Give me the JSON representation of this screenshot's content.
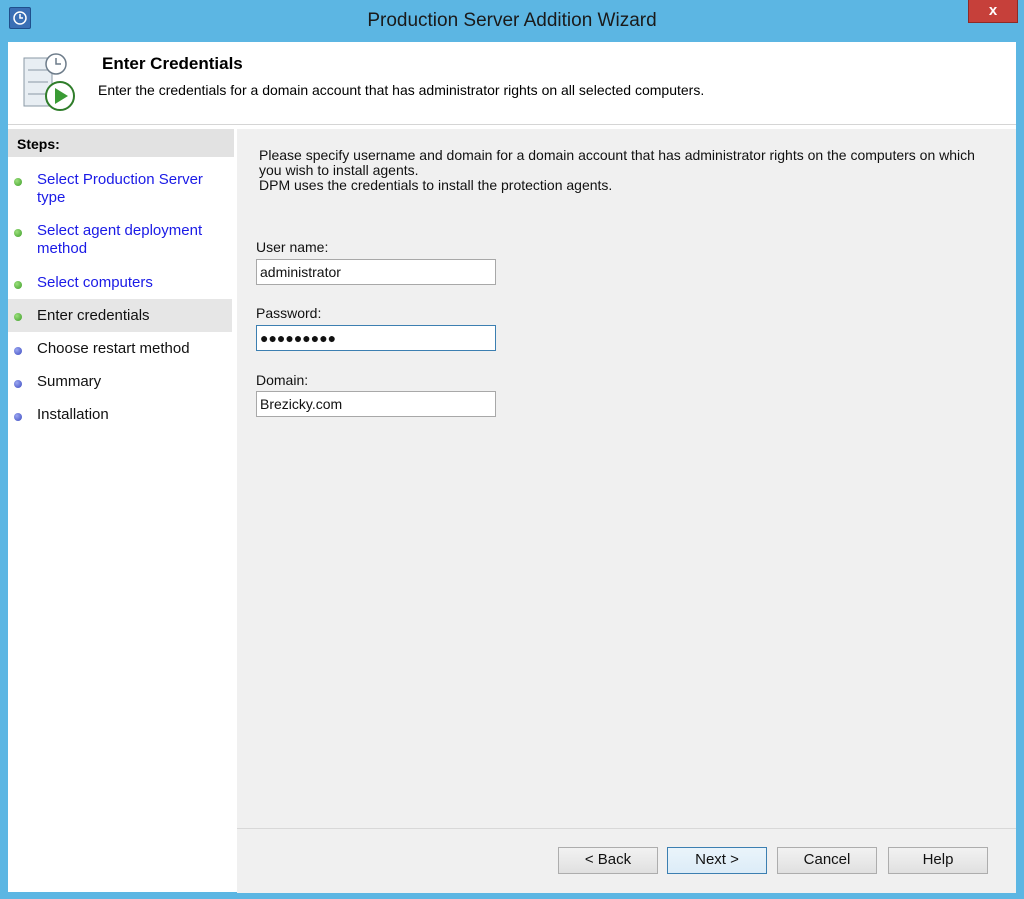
{
  "window": {
    "title": "Production Server Addition Wizard",
    "close_label": "x"
  },
  "header": {
    "title": "Enter Credentials",
    "subtitle": "Enter the credentials for a domain account that has administrator rights on all selected computers."
  },
  "steps": {
    "heading": "Steps:",
    "items": [
      {
        "label": "Select Production Server type",
        "state": "completed"
      },
      {
        "label": "Select agent deployment method",
        "state": "completed"
      },
      {
        "label": "Select computers",
        "state": "completed"
      },
      {
        "label": "Enter credentials",
        "state": "current"
      },
      {
        "label": "Choose restart method",
        "state": "pending"
      },
      {
        "label": "Summary",
        "state": "pending"
      },
      {
        "label": "Installation",
        "state": "pending"
      }
    ]
  },
  "main": {
    "description_line1": "Please specify username and domain for a domain account that has administrator rights on the computers on which you wish to install agents.",
    "description_line2": "DPM uses the credentials to install the protection agents.",
    "username": {
      "label": "User name:",
      "value": "administrator"
    },
    "password": {
      "label": "Password:",
      "value": "●●●●●●●●●"
    },
    "domain": {
      "label": "Domain:",
      "value": "Brezicky.com"
    }
  },
  "buttons": {
    "back": "< Back",
    "next": "Next >",
    "cancel": "Cancel",
    "help": "Help"
  },
  "colors": {
    "titlebar": "#5cb6e3",
    "link": "#1a1ae6",
    "step_done": "#3f9e2a",
    "step_pending": "#3d4cc2",
    "close": "#c6403a"
  }
}
